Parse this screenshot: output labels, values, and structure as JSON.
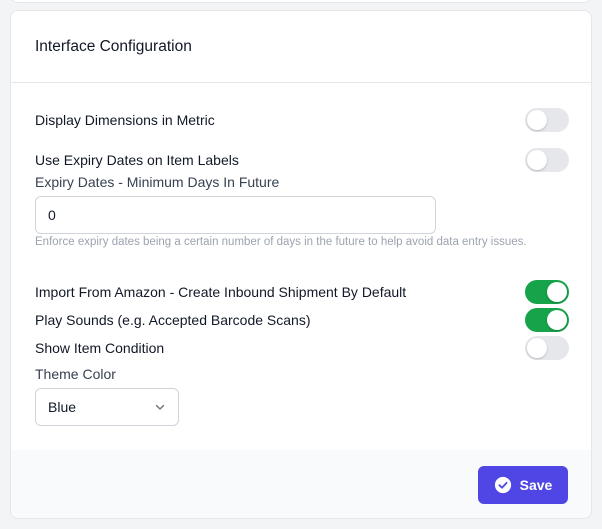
{
  "colors": {
    "accent": "#4f46e5",
    "toggle_on": "#16a34a",
    "toggle_off": "#e5e7eb"
  },
  "card": {
    "title": "Interface Configuration"
  },
  "settings": {
    "display_metric": {
      "label": "Display Dimensions in Metric",
      "enabled": false
    },
    "expiry_labels": {
      "label": "Use Expiry Dates on Item Labels",
      "enabled": false
    },
    "expiry_min_days": {
      "label": "Expiry Dates - Minimum Days In Future",
      "value": "0",
      "help": "Enforce expiry dates being a certain number of days in the future to help avoid data entry issues."
    },
    "amazon_inbound": {
      "label": "Import From Amazon - Create Inbound Shipment By Default",
      "enabled": true
    },
    "play_sounds": {
      "label": "Play Sounds (e.g. Accepted Barcode Scans)",
      "enabled": true
    },
    "item_condition": {
      "label": "Show Item Condition",
      "enabled": false
    },
    "theme_color": {
      "label": "Theme Color",
      "selected": "Blue",
      "icon": "chevron-down-icon"
    }
  },
  "footer": {
    "save_label": "Save",
    "save_icon": "check-circle-icon"
  }
}
